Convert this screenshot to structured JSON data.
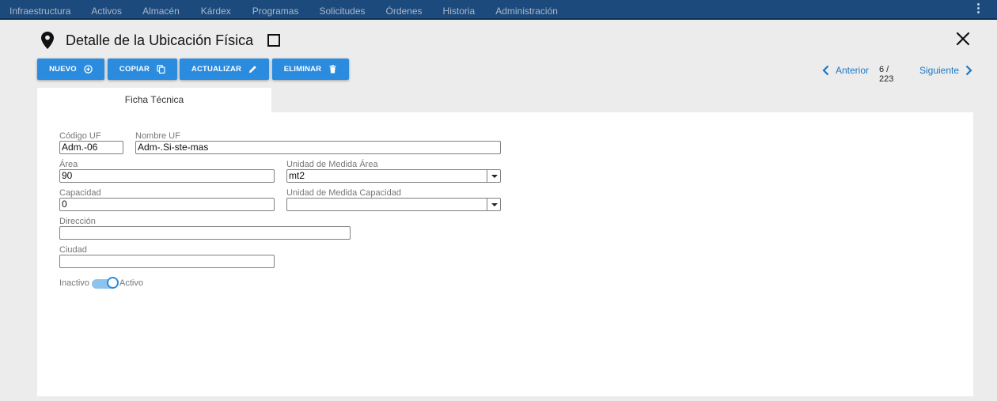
{
  "nav": {
    "items": [
      "Infraestructura",
      "Activos",
      "Almacén",
      "Kárdex",
      "Programas",
      "Solicitudes",
      "Órdenes",
      "Historia",
      "Administración"
    ]
  },
  "header": {
    "title": "Detalle de la Ubicación Física"
  },
  "toolbar": {
    "nuevo": "NUEVO",
    "copiar": "COPIAR",
    "actualizar": "ACTUALIZAR",
    "eliminar": "ELIMINAR"
  },
  "pager": {
    "prev": "Anterior",
    "count": "6 / 223",
    "next": "Siguiente"
  },
  "tabs": [
    "Ficha Técnica"
  ],
  "form": {
    "codigo_label": "Código UF",
    "codigo_value": "Adm.-06",
    "nombre_label": "Nombre UF",
    "nombre_value": "Adm-.Si-ste-mas",
    "area_label": "Área",
    "area_value": "90",
    "um_area_label": "Unidad de Medida Área",
    "um_area_value": "mt2",
    "capacidad_label": "Capacidad",
    "capacidad_value": "0",
    "um_cap_label": "Unidad de Medida Capacidad",
    "um_cap_value": "",
    "direccion_label": "Dirección",
    "direccion_value": "",
    "ciudad_label": "Ciudad",
    "ciudad_value": "",
    "toggle_off_label": "Inactivo",
    "toggle_on_label": "Activo",
    "toggle_active": true
  },
  "colors": {
    "nav_bg": "#1c4a7c",
    "primary": "#2b8cdf",
    "link": "#1d78c4"
  }
}
